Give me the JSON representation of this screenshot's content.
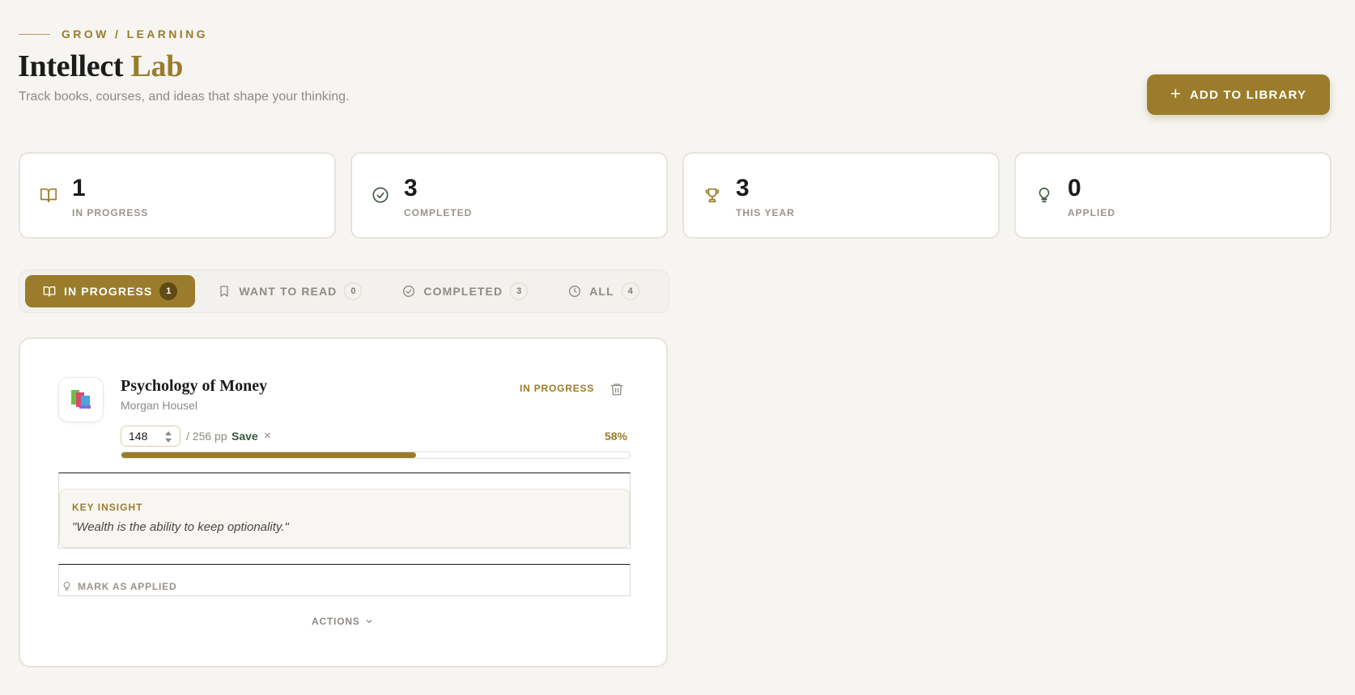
{
  "header": {
    "breadcrumb": "GROW / LEARNING",
    "title_main": "Intellect",
    "title_accent": "Lab",
    "subtitle": "Track books, courses, and ideas that shape your thinking.",
    "add_button": "ADD TO LIBRARY"
  },
  "stats": [
    {
      "value": "1",
      "label": "IN PROGRESS",
      "icon": "book-open-icon"
    },
    {
      "value": "3",
      "label": "COMPLETED",
      "icon": "check-circle-icon"
    },
    {
      "value": "3",
      "label": "THIS YEAR",
      "icon": "trophy-icon"
    },
    {
      "value": "0",
      "label": "APPLIED",
      "icon": "lightbulb-icon"
    }
  ],
  "tabs": [
    {
      "label": "IN PROGRESS",
      "count": "1",
      "icon": "book-open-icon",
      "active": true
    },
    {
      "label": "WANT TO READ",
      "count": "0",
      "icon": "bookmark-icon",
      "active": false
    },
    {
      "label": "COMPLETED",
      "count": "3",
      "icon": "check-circle-icon",
      "active": false
    },
    {
      "label": "ALL",
      "count": "4",
      "icon": "clock-icon",
      "active": false
    }
  ],
  "book": {
    "title": "Psychology of Money",
    "author": "Morgan Housel",
    "status": "IN PROGRESS",
    "current_page": "148",
    "total_pages": "/ 256 pp",
    "save_label": "Save",
    "cancel_label": "×",
    "percent": "58%",
    "progress_fraction": 0.58,
    "insight_label": "KEY INSIGHT",
    "insight_quote": "\"Wealth is the ability to keep optionality.\"",
    "mark_applied": "MARK AS APPLIED",
    "actions": "ACTIONS"
  },
  "colors": {
    "accent": "#9a7c2b",
    "background": "#f7f5f2",
    "save": "#3d5540"
  }
}
